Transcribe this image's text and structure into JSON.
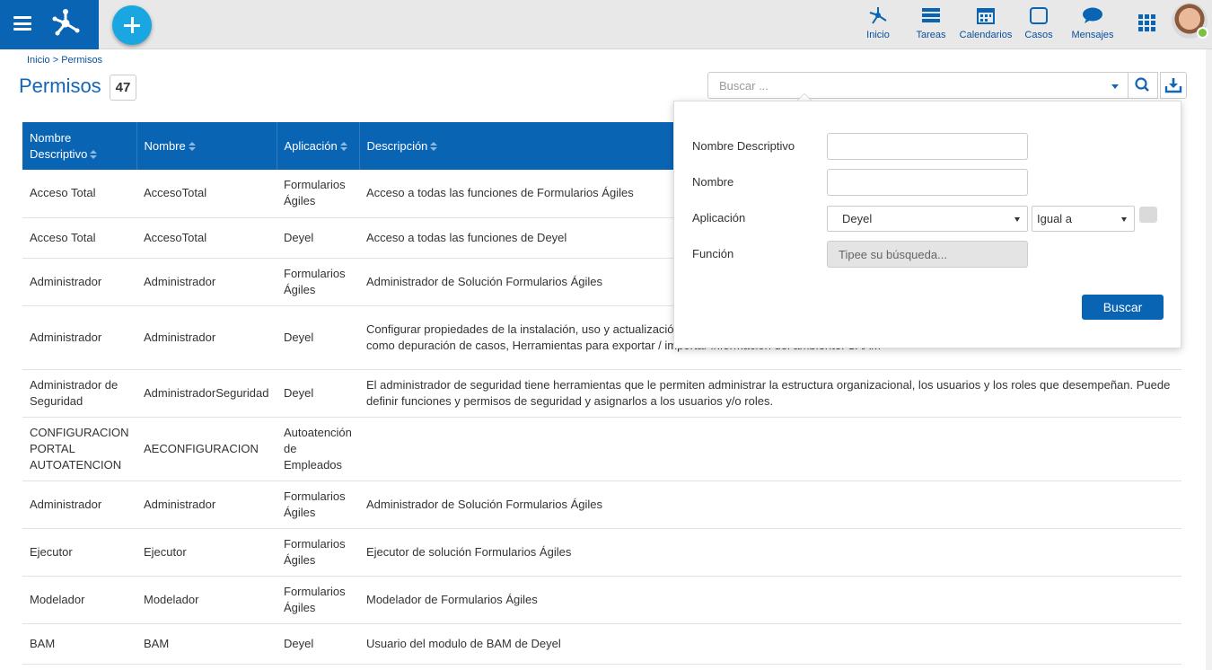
{
  "nav": {
    "items": [
      {
        "label": "Inicio",
        "icon": "deyel-icon"
      },
      {
        "label": "Tareas",
        "icon": "tasks-icon"
      },
      {
        "label": "Calendarios",
        "icon": "calendar-icon"
      },
      {
        "label": "Casos",
        "icon": "cases-icon"
      },
      {
        "label": "Mensajes",
        "icon": "messages-icon"
      }
    ]
  },
  "breadcrumb": "Inicio > Permisos",
  "page": {
    "title": "Permisos",
    "count": "47"
  },
  "search": {
    "placeholder": "Buscar ..."
  },
  "table": {
    "headers": [
      "Nombre Descriptivo",
      "Nombre",
      "Aplicación",
      "Descripción"
    ],
    "rows": [
      [
        "Acceso Total",
        "AccesoTotal",
        "Formularios Ágiles",
        "Acceso a todas las funciones de Formularios Ágiles"
      ],
      [
        "Acceso Total",
        "AccesoTotal",
        "Deyel",
        "Acceso a todas las funciones de Deyel"
      ],
      [
        "Administrador",
        "Administrador",
        "Formularios Ágiles",
        "Administrador de Solución Formularios Ágiles"
      ],
      [
        "Administrador",
        "Administrador",
        "Deyel",
        "Configurar propiedades de la instalación, uso y actualizació Fechas Particulares, glosarios Monitoreo y reinicio de tarea herramientas de tunning, tales como depuración de casos, Herramientas para exportar / importar información del ambiente. SAAM"
      ],
      [
        "Administrador de Seguridad",
        "AdministradorSeguridad",
        "Deyel",
        "El administrador de seguridad tiene herramientas que le permiten administrar la estructura organizacional, los usuarios y los roles que desempeñan. Puede definir funciones y permisos de seguridad y asignarlos a los usuarios y/o roles."
      ],
      [
        "CONFIGURACION PORTAL AUTOATENCION",
        "AECONFIGURACION",
        "Autoatención de Empleados",
        ""
      ],
      [
        "Administrador",
        "Administrador",
        "Formularios Ágiles",
        "Administrador de Solución Formularios Ágiles"
      ],
      [
        "Ejecutor",
        "Ejecutor",
        "Formularios Ágiles",
        "Ejecutor de solución Formularios Ágiles"
      ],
      [
        "Modelador",
        "Modelador",
        "Formularios Ágiles",
        "Modelador de Formularios Ágiles"
      ],
      [
        "BAM",
        "BAM",
        "Deyel",
        "Usuario del modulo de BAM de Deyel"
      ]
    ]
  },
  "filter": {
    "nombre_descriptivo_label": "Nombre Descriptivo",
    "nombre_label": "Nombre",
    "aplicacion_label": "Aplicación",
    "aplicacion_value": "Deyel",
    "operator_value": "Igual a",
    "funcion_label": "Función",
    "funcion_placeholder": "Tipee su búsqueda...",
    "submit_label": "Buscar"
  },
  "colors": {
    "primary": "#0a64b4",
    "accent": "#1aa6e0",
    "status_online": "#7cc242"
  }
}
